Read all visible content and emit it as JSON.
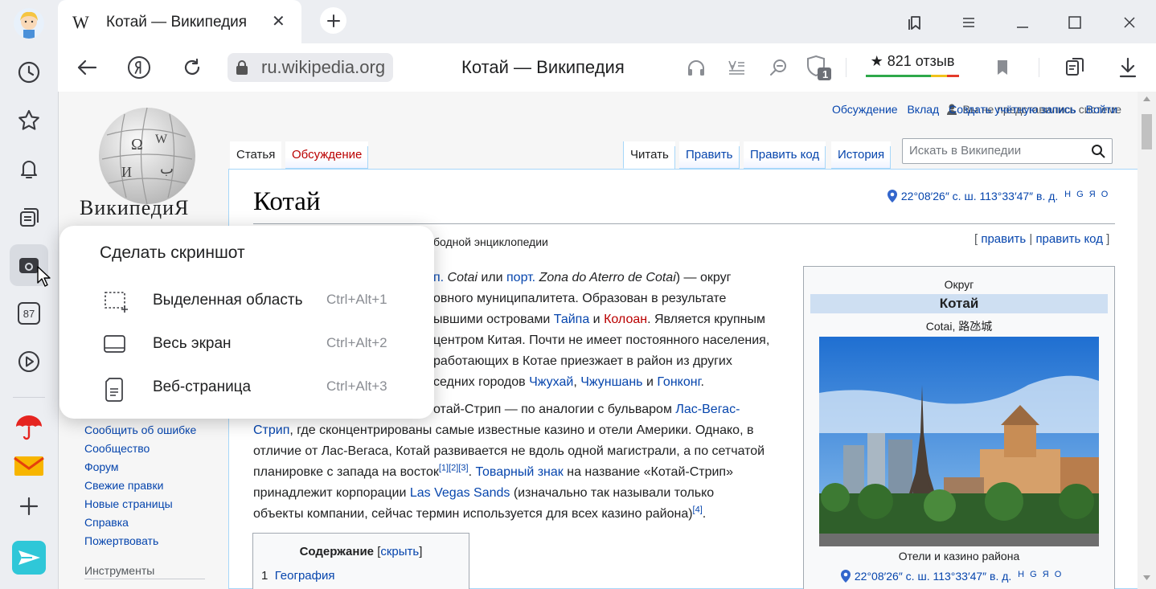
{
  "browser": {
    "tab": {
      "favicon": "W",
      "title": "Котай — Википедия",
      "close": "✕"
    },
    "address": {
      "url": "ru.wikipedia.org",
      "page_title": "Котай — Википедия"
    },
    "reviews": {
      "text": "★ 821 отзыв"
    },
    "shield_badge": "1",
    "sidebar_counter": "87",
    "colors": {
      "accent_green": "#2ea84a",
      "accent_red": "#e43a2a",
      "link": "#0645ad"
    }
  },
  "popup": {
    "title": "Сделать скриншот",
    "items": [
      {
        "label": "Выделенная область",
        "shortcut": "Ctrl+Alt+1",
        "icon": "selection-area-icon"
      },
      {
        "label": "Весь экран",
        "shortcut": "Ctrl+Alt+2",
        "icon": "full-screen-icon"
      },
      {
        "label": "Веб-страница",
        "shortcut": "Ctrl+Alt+3",
        "icon": "web-page-icon"
      }
    ]
  },
  "wiki": {
    "logo_text": "ВикипедиЯ",
    "personal": {
      "anon": "Вы не представились системе",
      "talk": "Обсуждение",
      "contrib": "Вклад",
      "create": "Создать учётную запись",
      "login": "Войти"
    },
    "tabs": {
      "article": "Статья",
      "talk": "Обсуждение",
      "read": "Читать",
      "edit": "Править",
      "edit_source": "Править код",
      "history": "История"
    },
    "search_placeholder": "Искать в Википедии",
    "title": "Котай",
    "coords": "22°08′26″ с. ш. 113°33′47″ в. д.",
    "coords_links": "H G Я O",
    "tagline": "бодной энциклопедии",
    "edit": {
      "open": "[",
      "edit": "править",
      "sep": "|",
      "edit_source": "править код",
      "close": "]"
    },
    "p1": {
      "l1_link1": "п.",
      "l1_t1": " Cotai",
      "l1_t2": " или ",
      "l1_link2": "порт.",
      "l1_t3": " Zona do Aterro de Cotai",
      "l1_t4": ") — округ",
      "l2": "овного муниципалитета. Образован в результате",
      "l3_t1": "ывшими островами ",
      "l3_link1": "Тайпа",
      "l3_t2": " и ",
      "l3_link2": "Колоан",
      "l3_t3": ". Является крупным",
      "l4": "центром Китая. Почти не имеет постоянного населения,",
      "l5": "работающих в Котае приезжает в район из других",
      "l6_t1": "седних городов ",
      "l6_link1": "Чжухай",
      "l6_t2": ", ",
      "l6_link2": "Чжуншань",
      "l6_t3": " и ",
      "l6_link3": "Гонконг",
      "l6_t4": "."
    },
    "p2": {
      "l1_t1": "отай-Стрип — по аналогии с бульваром ",
      "l1_link": "Лас-Вегас-",
      "l2_link": "Стрип",
      "l2_t": ", где сконцентрированы самые известные казино и отели Америки. Однако, в",
      "l3": "отличие от Лас-Вегаса, Котай развивается не вдоль одной магистрали, а по сетчатой",
      "l4_t1": "планировке с запада на восток",
      "l4_refs": "[1][2][3]",
      "l4_t2": ". ",
      "l4_link": "Товарный знак",
      "l4_t3": " на название «Котай-Стрип»",
      "l5_t1": "принадлежит корпорации ",
      "l5_link": "Las Vegas Sands",
      "l5_t2": " (изначально так называли только",
      "l6_t1": "объекты компании, сейчас термин используется для всех казино района)",
      "l6_ref": "[4]",
      "l6_t2": "."
    },
    "toc": {
      "title": "Содержание",
      "toggle_open": "[",
      "toggle": "скрыть",
      "toggle_close": "]",
      "item_num": "1",
      "item": "География"
    },
    "infobox": {
      "label": "Округ",
      "name": "Котай",
      "sub": "Cotai, 路氹城",
      "caption": "Отели и казино района",
      "coords": "22°08′26″ с. ш. 113°33′47″ в. д.",
      "coords_links": "H G Я O"
    },
    "sidebar": [
      "Сообщить об ошибке",
      "Сообщество",
      "Форум",
      "Свежие правки",
      "Новые страницы",
      "Справка",
      "Пожертвовать"
    ],
    "tools_heading": "Инструменты"
  }
}
